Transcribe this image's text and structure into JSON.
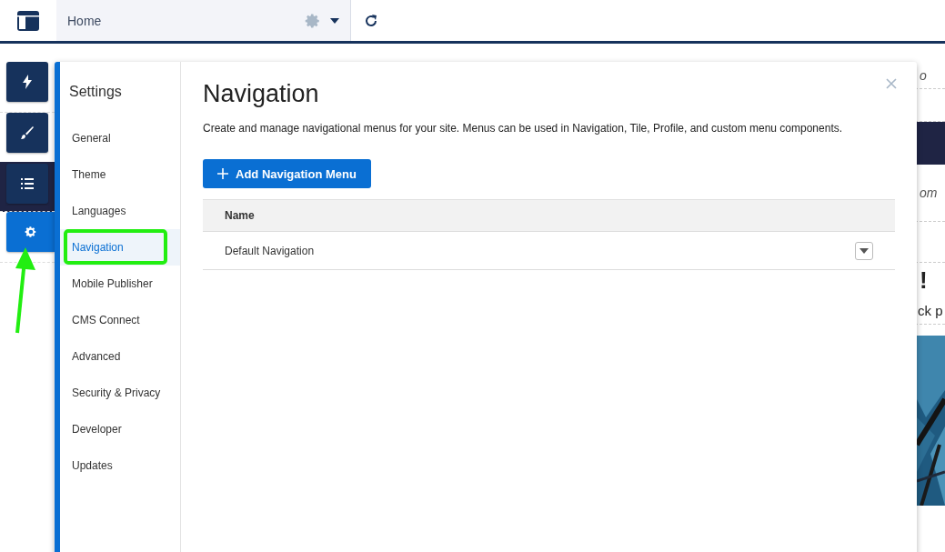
{
  "topbar": {
    "tab": {
      "label": "Home",
      "selected": true
    }
  },
  "rail": [
    {
      "kind": "bolt",
      "selected": false
    },
    {
      "kind": "brush",
      "selected": false
    },
    {
      "kind": "list",
      "selected": false
    },
    {
      "kind": "gear",
      "selected": true
    }
  ],
  "background": {
    "texts": [
      {
        "kind": "italic",
        "text": "o"
      },
      {
        "kind": "italic",
        "text": "om"
      },
      {
        "kind": "heading",
        "text": "!"
      },
      {
        "kind": "body",
        "text": "ck p"
      }
    ]
  },
  "settings": {
    "title": "Settings",
    "items": [
      {
        "label": "General",
        "selected": false
      },
      {
        "label": "Theme",
        "selected": false
      },
      {
        "label": "Languages",
        "selected": false
      },
      {
        "label": "Navigation",
        "selected": true
      },
      {
        "label": "Mobile Publisher",
        "selected": false
      },
      {
        "label": "CMS Connect",
        "selected": false
      },
      {
        "label": "Advanced",
        "selected": false
      },
      {
        "label": "Security & Privacy",
        "selected": false
      },
      {
        "label": "Developer",
        "selected": false
      },
      {
        "label": "Updates",
        "selected": false
      }
    ],
    "heading": "Navigation",
    "description": "Create and manage navigational menus for your site. Menus can be used in Navigation, Tile, Profile, and custom menu components.",
    "add_button": "Add Navigation Menu",
    "table": {
      "columns": [
        "Name"
      ],
      "rows": [
        [
          "Default Navigation"
        ]
      ]
    }
  }
}
